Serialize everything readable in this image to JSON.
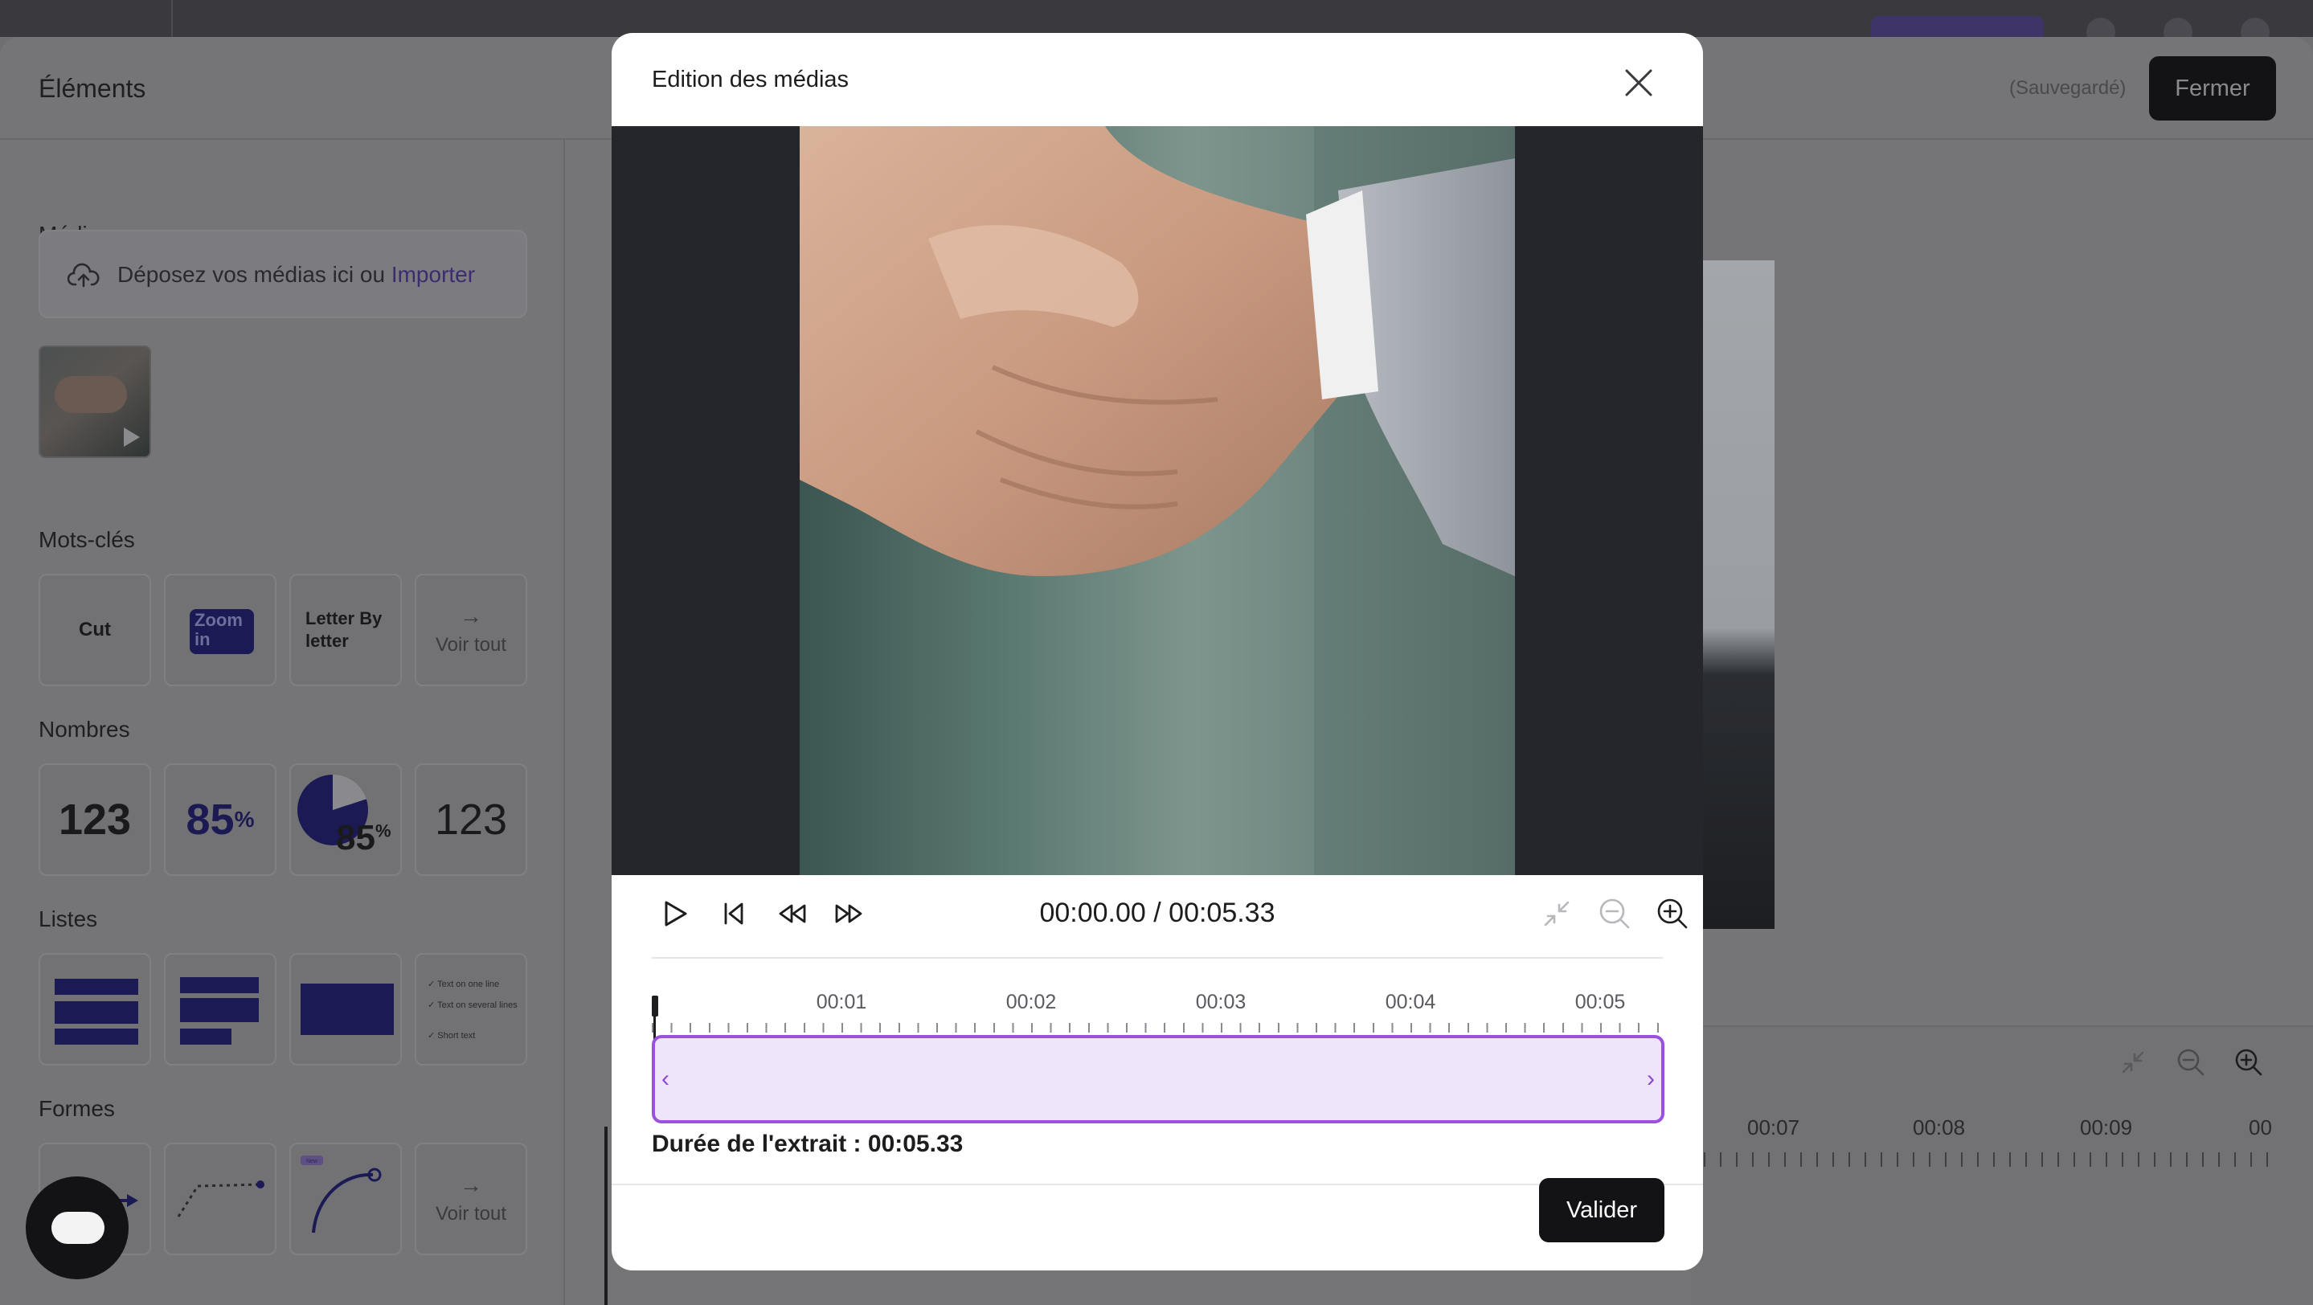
{
  "editor": {
    "title": "Éléments",
    "saved_status": "(Sauvegardé)",
    "close_label": "Fermer"
  },
  "sidebar": {
    "medias": {
      "title": "Médias",
      "drop_text": "Déposez vos médias ici ou ",
      "import_link": "Importer"
    },
    "keywords": {
      "title": "Mots-clés",
      "items": [
        "Cut",
        "Zoom in",
        "Letter By letter"
      ],
      "see_all": "Voir tout"
    },
    "numbers": {
      "title": "Nombres",
      "items": [
        "123",
        "85",
        "85",
        "123"
      ],
      "percent_sign": "%"
    },
    "lists": {
      "title": "Listes",
      "checklist": [
        "Text on one line",
        "Text on several lines",
        "Short text"
      ]
    },
    "shapes": {
      "title": "Formes",
      "new_badge": "New",
      "see_all": "Voir tout"
    }
  },
  "background_timeline": {
    "labels": [
      "00:07",
      "00:08",
      "00:09",
      "00"
    ]
  },
  "modal": {
    "title": "Edition des médias",
    "timecode": "00:00.00 / 00:05.33",
    "ruler_labels": [
      "00:01",
      "00:02",
      "00:03",
      "00:04",
      "00:05"
    ],
    "duration_label": "Durée de l'extrait : 00:05.33",
    "validate_label": "Valider",
    "accent_color": "#9a52dd",
    "clip_fill": "#efe5fb"
  },
  "icons": [
    "close-icon",
    "play-icon",
    "skip-back-icon",
    "rewind-icon",
    "fast-forward-icon",
    "fit-icon",
    "zoom-out-icon",
    "zoom-in-icon",
    "upload-cloud-icon",
    "chat-icon"
  ]
}
